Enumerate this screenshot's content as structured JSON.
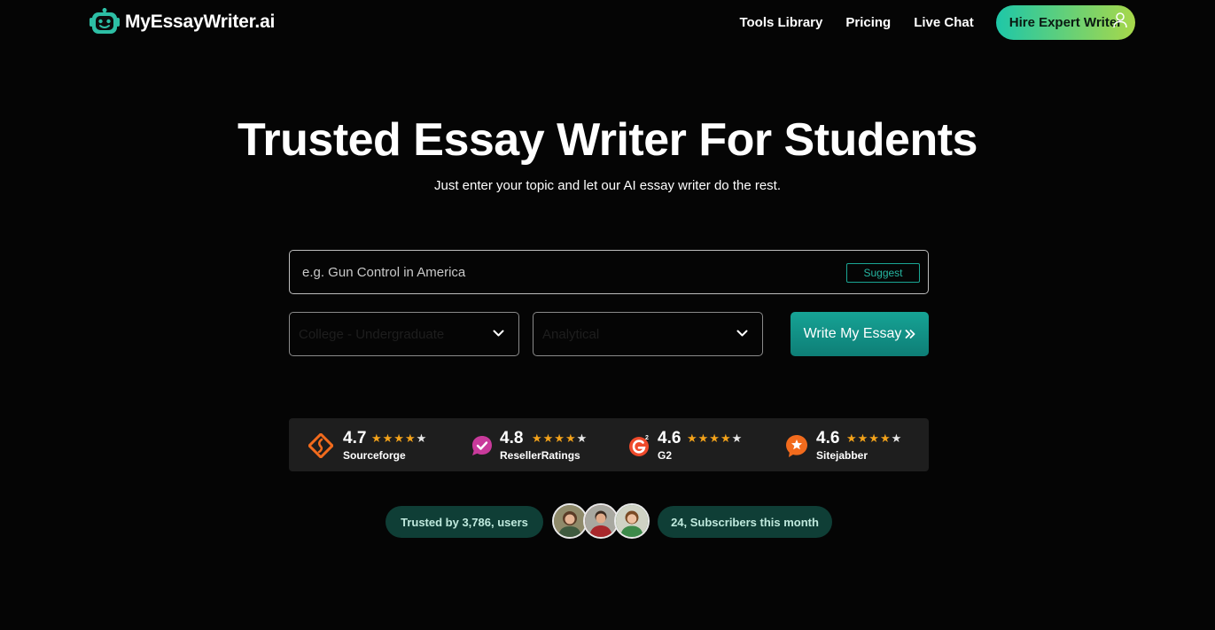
{
  "header": {
    "brand": "MyEssayWriter.ai",
    "nav": [
      "Tools Library",
      "Pricing",
      "Live Chat"
    ],
    "cta": "Hire Expert Writer"
  },
  "hero": {
    "title": "Trusted Essay Writer For Students",
    "subtitle": "Just enter your topic and let our AI essay writer do the rest."
  },
  "form": {
    "topic_placeholder": "e.g. Gun Control in America",
    "topic_value": "",
    "suggest_label": "Suggest",
    "level_value": "College - Undergraduate",
    "type_value": "Analytical",
    "submit_label": "Write My Essay"
  },
  "ratings": [
    {
      "score": "4.7",
      "name": "Sourceforge",
      "rating": 4.7,
      "logo": "sourceforge-logo",
      "color": "#f26b1d"
    },
    {
      "score": "4.8",
      "name": "ResellerRatings",
      "rating": 4.8,
      "logo": "resellerratings-logo",
      "color": "#c93a9b"
    },
    {
      "score": "4.6",
      "name": "G2",
      "rating": 4.6,
      "logo": "g2-logo",
      "color": "#ef4a2b"
    },
    {
      "score": "4.6",
      "name": "Sitejabber",
      "rating": 4.6,
      "logo": "sitejabber-logo",
      "color": "#f26b1d"
    }
  ],
  "trust": {
    "users_text": "Trusted by 3,786, users",
    "subscribers_text": "24, Subscribers this month"
  },
  "colors": {
    "accent_teal": "#16a395",
    "cta_gradient_start": "#1ec7a8",
    "cta_gradient_end": "#a8d84a",
    "star": "#f3a21a",
    "pill_bg": "#0f3e36"
  }
}
